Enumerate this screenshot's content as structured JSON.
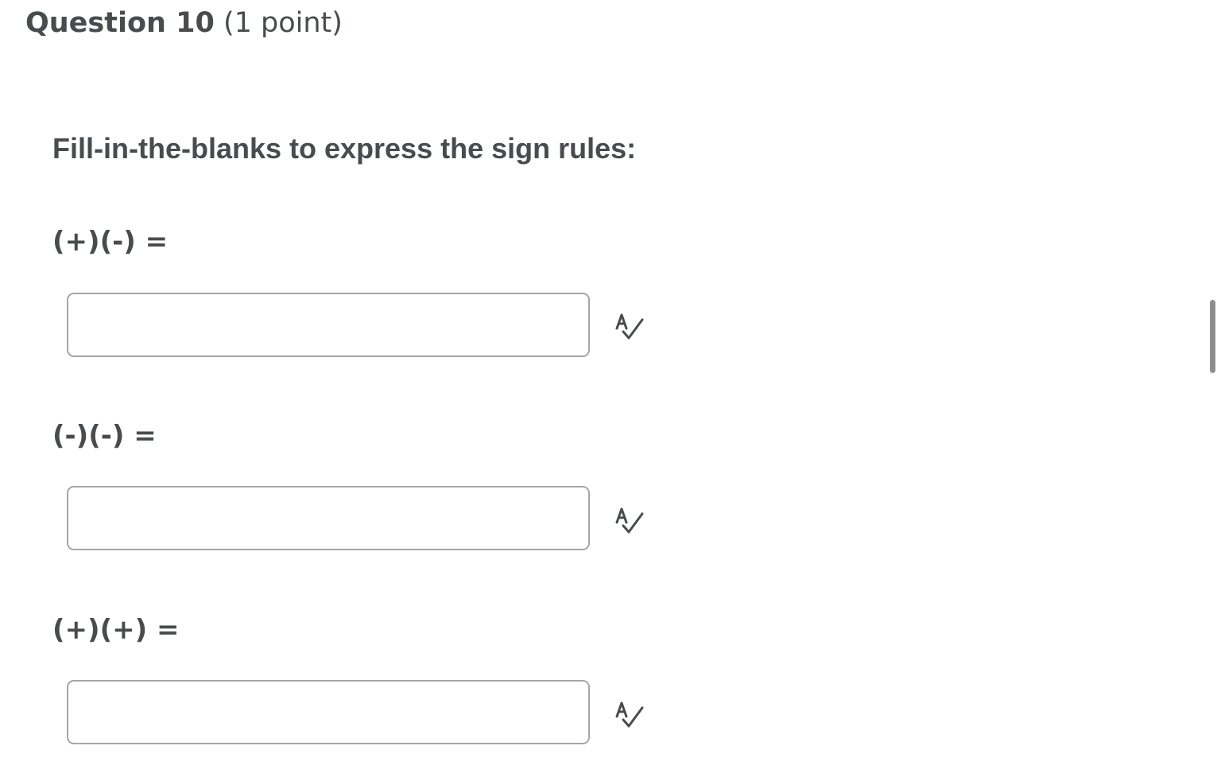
{
  "question": {
    "title": "Question 10",
    "points": "(1 point)"
  },
  "prompt": "Fill-in-the-blanks to express the sign rules:",
  "blanks": [
    {
      "label": "(+)(-) =",
      "value": "",
      "spellcheck_icon": "spellcheck-icon"
    },
    {
      "label": "(-)(-) =",
      "value": "",
      "spellcheck_icon": "spellcheck-icon"
    },
    {
      "label": "(+)(+) =",
      "value": "",
      "spellcheck_icon": "spellcheck-icon"
    }
  ],
  "colors": {
    "text": "#494c4e",
    "input_border": "#a3a6aa",
    "scrollbar": "#8e8e8e"
  }
}
